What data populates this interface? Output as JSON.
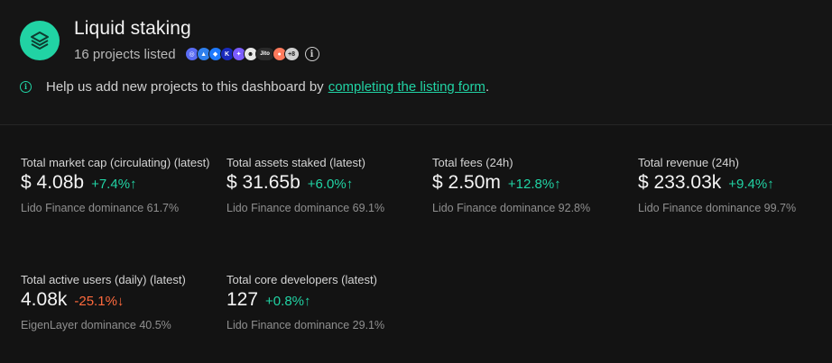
{
  "header": {
    "title": "Liquid staking",
    "subtitle": "16 projects listed",
    "more_projects": "+8",
    "project_icons": [
      {
        "name": "project-icon-1",
        "color": "#5a6cf3",
        "glyph": "◎"
      },
      {
        "name": "project-icon-2",
        "color": "#2f80ed",
        "glyph": "▲"
      },
      {
        "name": "project-icon-3",
        "color": "#1f7aff",
        "glyph": "◆"
      },
      {
        "name": "project-icon-4",
        "color": "#1a2bbd",
        "glyph": "K"
      },
      {
        "name": "project-icon-5",
        "color": "#7b5cff",
        "glyph": "✦"
      },
      {
        "name": "project-icon-6",
        "color": "#e8e8e8",
        "glyph": "☻"
      },
      {
        "name": "project-icon-7",
        "color": "#2a2a2a",
        "glyph": "Jito"
      },
      {
        "name": "project-icon-8",
        "color": "#ff7a5c",
        "glyph": "●"
      }
    ],
    "help_text": "Help us add new projects to this dashboard by",
    "help_link": "completing the listing form",
    "help_end": "."
  },
  "metrics": [
    {
      "label": "Total market cap (circulating) (latest)",
      "value": "$ 4.08b",
      "change": "+7.4%↑",
      "direction": "up",
      "dominance": "Lido Finance dominance 61.7%"
    },
    {
      "label": "Total assets staked (latest)",
      "value": "$ 31.65b",
      "change": "+6.0%↑",
      "direction": "up",
      "dominance": "Lido Finance dominance 69.1%"
    },
    {
      "label": "Total fees (24h)",
      "value": "$ 2.50m",
      "change": "+12.8%↑",
      "direction": "up",
      "dominance": "Lido Finance dominance 92.8%"
    },
    {
      "label": "Total revenue (24h)",
      "value": "$ 233.03k",
      "change": "+9.4%↑",
      "direction": "up",
      "dominance": "Lido Finance dominance 99.7%"
    },
    {
      "label": "Total active users (daily) (latest)",
      "value": "4.08k",
      "change": "-25.1%↓",
      "direction": "down",
      "dominance": "EigenLayer dominance 40.5%"
    },
    {
      "label": "Total core developers (latest)",
      "value": "127",
      "change": "+0.8%↑",
      "direction": "up",
      "dominance": "Lido Finance dominance 29.1%"
    }
  ],
  "colors": {
    "accent": "#21d3a4",
    "negative": "#ff6a3d",
    "background": "#131313"
  }
}
